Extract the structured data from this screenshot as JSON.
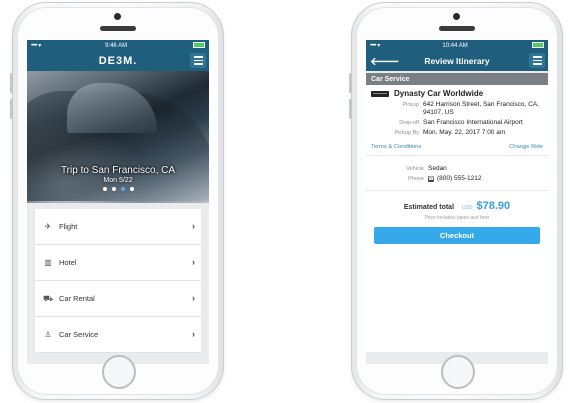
{
  "left_phone": {
    "status_bar": {
      "signal": "•••••",
      "wifi": "▾",
      "time": "9:46 AM",
      "battery": "▪"
    },
    "header": {
      "logo": "DE3M.",
      "menu_icon": "hamburger-icon"
    },
    "hero": {
      "caption": "Trip to San Francisco, CA",
      "date": "Mon 5/22",
      "pages": 4,
      "active_page": 3
    },
    "menu": [
      {
        "label": "Flight",
        "icon": "plane-icon"
      },
      {
        "label": "Hotel",
        "icon": "hotel-icon"
      },
      {
        "label": "Car Rental",
        "icon": "car-icon"
      },
      {
        "label": "Car Service",
        "icon": "car-service-icon"
      }
    ]
  },
  "right_phone": {
    "status_bar": {
      "signal": "•••••",
      "wifi": "▾",
      "time": "10:44 AM",
      "battery": "▪"
    },
    "header": {
      "title": "Review Itinerary",
      "back_icon": "back-arrow-icon",
      "menu_icon": "hamburger-icon"
    },
    "section": "Car Service",
    "vendor": "Dynasty Car Worldwide",
    "details": [
      {
        "label": "Pickup",
        "value": "642 Harrison Street, San Francisco, CA, 94107, US"
      },
      {
        "label": "Drop-off",
        "value": "San Francisco International Airport"
      },
      {
        "label": "Pickup By",
        "value": "Mon. May. 22, 2017 7:00 am"
      }
    ],
    "links": {
      "terms": "Terms & Conditions",
      "change": "Change Ride"
    },
    "vehicle": [
      {
        "label": "Vehicle",
        "value": "Sedan"
      },
      {
        "label": "Phone",
        "value": "(800) 555-1212"
      }
    ],
    "total": {
      "label": "Estimated total",
      "currency": "USD",
      "amount": "$78.90",
      "note": "Price includes taxes and fees"
    },
    "checkout_label": "Checkout"
  },
  "colors": {
    "nav": "#1f5f7d",
    "accent": "#35a9ea",
    "section": "#7a7f84"
  }
}
